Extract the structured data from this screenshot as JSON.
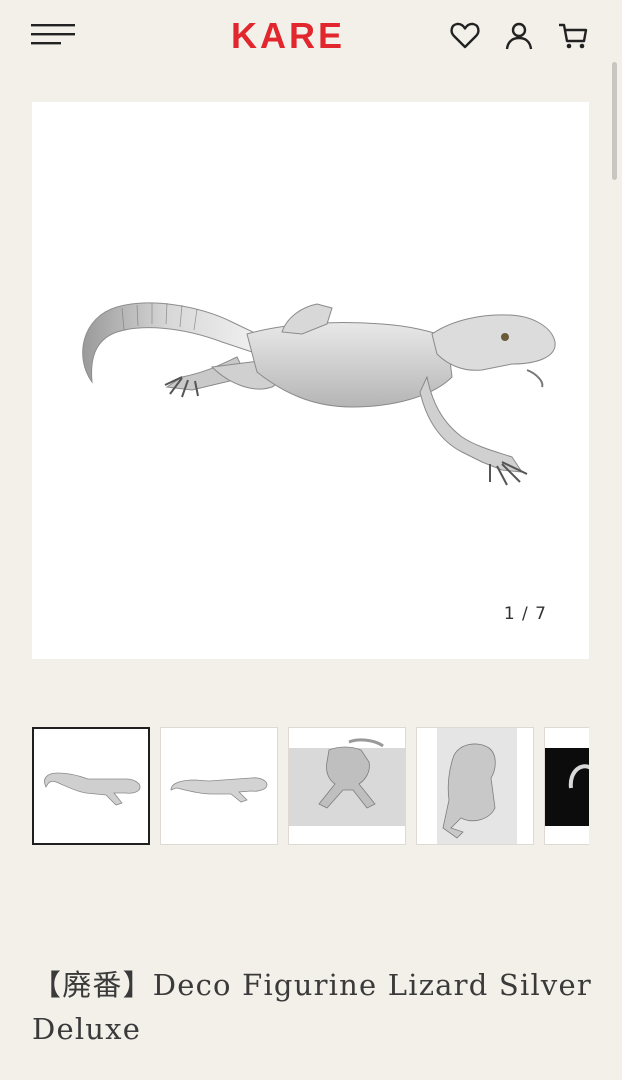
{
  "header": {
    "logo_text": "KARE",
    "brand_color": "#e1262d",
    "icons": [
      "menu-icon",
      "heart-icon",
      "account-icon",
      "cart-icon"
    ]
  },
  "gallery": {
    "counter": "1 / 7",
    "thumbnails": [
      {
        "name": "lizard-top-view",
        "active": true
      },
      {
        "name": "lizard-side-view",
        "active": false
      },
      {
        "name": "lizard-front-view",
        "active": false
      },
      {
        "name": "lizard-closeup",
        "active": false
      },
      {
        "name": "lizard-tail-dark",
        "active": false
      }
    ]
  },
  "product": {
    "title": "【廃番】Deco Figurine Lizard Silver Deluxe"
  }
}
